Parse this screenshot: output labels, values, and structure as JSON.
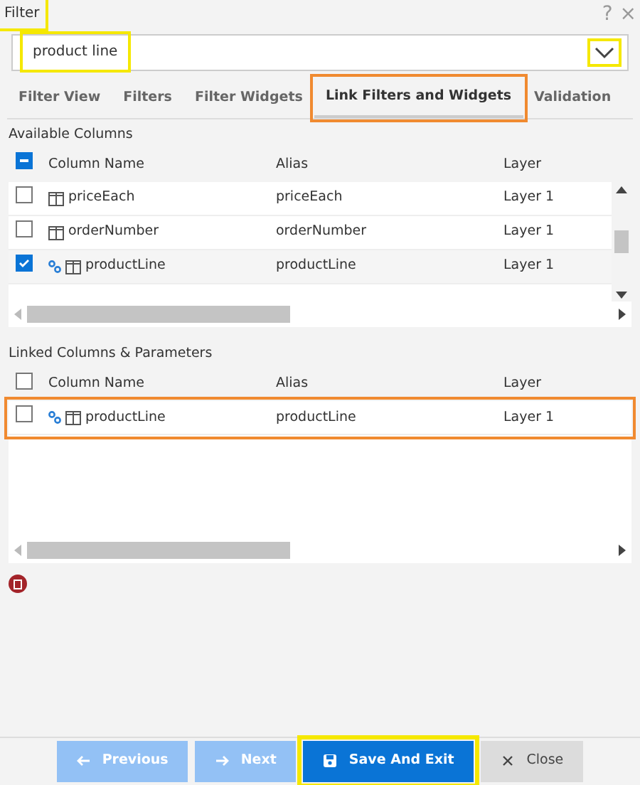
{
  "window": {
    "title": "Filter",
    "highlighted": true,
    "help": "?",
    "close": "×"
  },
  "select": {
    "value": "product line",
    "highlighted": true,
    "caret_highlighted": true
  },
  "tabs": [
    {
      "label": "Filter View",
      "selected": false
    },
    {
      "label": "Filters",
      "selected": false
    },
    {
      "label": "Filter Widgets",
      "selected": false
    },
    {
      "label": "Link Filters and Widgets",
      "selected": true,
      "highlighted": true
    },
    {
      "label": "Validation",
      "selected": false
    }
  ],
  "available": {
    "title": "Available Columns",
    "header_checked": true,
    "header_partial": true,
    "columns": [
      "Column Name",
      "Alias",
      "Layer"
    ],
    "rows": [
      {
        "name": "priceEach",
        "alias": "priceEach",
        "layer": "Layer 1",
        "checked": false,
        "linked": false
      },
      {
        "name": "orderNumber",
        "alias": "orderNumber",
        "layer": "Layer 1",
        "checked": false,
        "linked": false
      },
      {
        "name": "productLine",
        "alias": "productLine",
        "layer": "Layer 1",
        "checked": true,
        "linked": true
      }
    ]
  },
  "linked": {
    "title": "Linked Columns & Parameters",
    "header_checked": false,
    "columns": [
      "Column Name",
      "Alias",
      "Layer"
    ],
    "rows": [
      {
        "name": "productLine",
        "alias": "productLine",
        "layer": "Layer 1",
        "checked": false,
        "linked": true,
        "highlighted": true
      }
    ]
  },
  "buttons": [
    {
      "label": "Previous",
      "kind": "previous",
      "disabled": true
    },
    {
      "label": "Next",
      "kind": "next",
      "disabled": true
    },
    {
      "label": "Save And Exit",
      "kind": "save",
      "disabled": false,
      "highlighted": true
    },
    {
      "label": "Close",
      "kind": "close",
      "disabled": false
    }
  ]
}
